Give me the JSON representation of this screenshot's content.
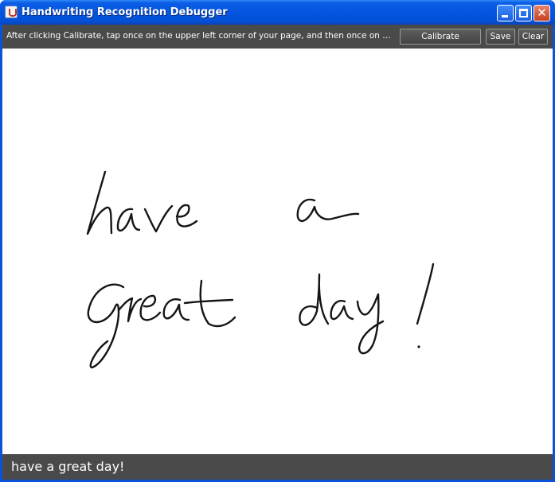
{
  "window": {
    "title": "Handwriting Recognition Debugger",
    "icon": "java-cup-icon",
    "title_color": "#0a52d8"
  },
  "toolbar": {
    "instructions": "After clicking Calibrate, tap once on the upper left corner of your page, and then once on the low...",
    "calibrate_label": "Calibrate",
    "save_label": "Save",
    "clear_label": "Clear",
    "background": "#4a4a4a"
  },
  "result": {
    "text": "have a great day!"
  }
}
